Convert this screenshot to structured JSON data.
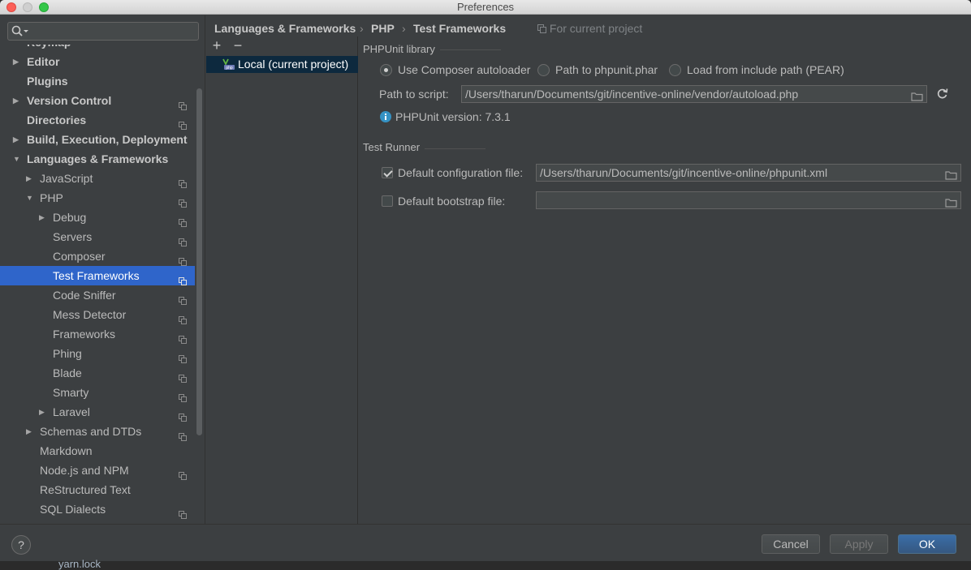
{
  "window": {
    "title": "Preferences"
  },
  "search": {
    "placeholder": ""
  },
  "tree": {
    "items": [
      {
        "label": "Keymap",
        "bold": true,
        "arrow": "",
        "copy": false
      },
      {
        "label": "Editor",
        "bold": true,
        "arrow": "right",
        "copy": false
      },
      {
        "label": "Plugins",
        "bold": true,
        "arrow": "",
        "copy": false
      },
      {
        "label": "Version Control",
        "bold": true,
        "arrow": "right",
        "copy": true
      },
      {
        "label": "Directories",
        "bold": true,
        "arrow": "",
        "copy": true
      },
      {
        "label": "Build, Execution, Deployment",
        "bold": true,
        "arrow": "right",
        "copy": false
      },
      {
        "label": "Languages & Frameworks",
        "bold": true,
        "arrow": "down",
        "copy": false
      },
      {
        "label": "JavaScript",
        "bold": false,
        "arrow": "right",
        "copy": true
      },
      {
        "label": "PHP",
        "bold": false,
        "arrow": "down",
        "copy": true
      },
      {
        "label": "Debug",
        "bold": false,
        "arrow": "right",
        "copy": true
      },
      {
        "label": "Servers",
        "bold": false,
        "arrow": "",
        "copy": true
      },
      {
        "label": "Composer",
        "bold": false,
        "arrow": "",
        "copy": true
      },
      {
        "label": "Test Frameworks",
        "bold": false,
        "arrow": "",
        "copy": true,
        "selected": true
      },
      {
        "label": "Code Sniffer",
        "bold": false,
        "arrow": "",
        "copy": true
      },
      {
        "label": "Mess Detector",
        "bold": false,
        "arrow": "",
        "copy": true
      },
      {
        "label": "Frameworks",
        "bold": false,
        "arrow": "",
        "copy": true
      },
      {
        "label": "Phing",
        "bold": false,
        "arrow": "",
        "copy": true
      },
      {
        "label": "Blade",
        "bold": false,
        "arrow": "",
        "copy": true
      },
      {
        "label": "Smarty",
        "bold": false,
        "arrow": "",
        "copy": true
      },
      {
        "label": "Laravel",
        "bold": false,
        "arrow": "right",
        "copy": true
      },
      {
        "label": "Schemas and DTDs",
        "bold": false,
        "arrow": "right",
        "copy": true
      },
      {
        "label": "Markdown",
        "bold": false,
        "arrow": "",
        "copy": false
      },
      {
        "label": "Node.js and NPM",
        "bold": false,
        "arrow": "",
        "copy": true
      },
      {
        "label": "ReStructured Text",
        "bold": false,
        "arrow": "",
        "copy": false
      },
      {
        "label": "SQL Dialects",
        "bold": false,
        "arrow": "",
        "copy": true
      }
    ]
  },
  "middle": {
    "add_label": "+",
    "remove_label": "−",
    "item_label": "Local (current project)"
  },
  "breadcrumb": {
    "part1": "Languages & Frameworks",
    "sep": "›",
    "part2": "PHP",
    "part3": "Test Frameworks",
    "project_note": "For current project"
  },
  "phpunit": {
    "section_title": "PHPUnit library",
    "options": [
      {
        "label": "Use Composer autoloader",
        "checked": true
      },
      {
        "label": "Path to phpunit.phar",
        "checked": false
      },
      {
        "label": "Load from include path (PEAR)",
        "checked": false
      }
    ],
    "path_label": "Path to script:",
    "path_value": "/Users/tharun/Documents/git/incentive-online/vendor/autoload.php",
    "version_text": "PHPUnit version: 7.3.1"
  },
  "test_runner": {
    "section_title": "Test Runner",
    "config_label": "Default configuration file:",
    "config_checked": true,
    "config_value": "/Users/tharun/Documents/git/incentive-online/phpunit.xml",
    "bootstrap_label": "Default bootstrap file:",
    "bootstrap_checked": false,
    "bootstrap_value": ""
  },
  "buttons": {
    "help": "?",
    "cancel": "Cancel",
    "apply": "Apply",
    "ok": "OK"
  },
  "behind": {
    "file_label": "yarn.lock"
  },
  "colors": {
    "selection": "#2f65ca",
    "primary_button": "#365880",
    "info_icon": "#3592c4"
  }
}
